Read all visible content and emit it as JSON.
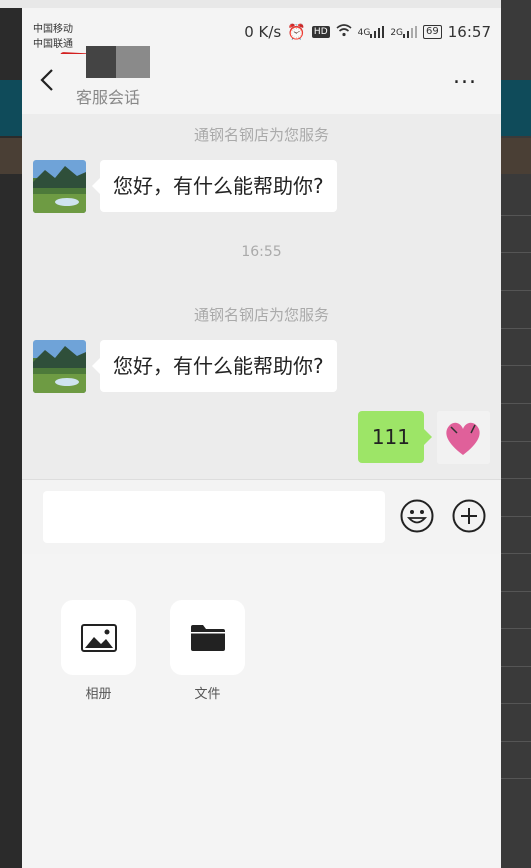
{
  "status_bar": {
    "carrier_1": "中国移动",
    "carrier_2": "中国联通",
    "net_speed": "0 K/s",
    "signal_1": "4G",
    "signal_2": "2G",
    "battery": "69",
    "time": "16:57"
  },
  "header": {
    "back_icon": "chevron-left-icon",
    "subtitle": "客服会话",
    "more_label": "..."
  },
  "messages": [
    {
      "type": "system",
      "text": "通钢名钢店为您服务"
    },
    {
      "type": "incoming",
      "text": "您好，有什么能帮助你?"
    },
    {
      "type": "time",
      "text": "16:55"
    },
    {
      "type": "system",
      "text": "通钢名钢店为您服务"
    },
    {
      "type": "incoming",
      "text": "您好，有什么能帮助你?"
    },
    {
      "type": "outgoing",
      "text": "111"
    }
  ],
  "input": {
    "value": "",
    "placeholder": ""
  },
  "toolbar": {
    "emoji_icon": "emoji-icon",
    "plus_icon": "plus-circle-icon"
  },
  "panel": {
    "items": [
      {
        "label": "相册",
        "icon": "image-icon"
      },
      {
        "label": "文件",
        "icon": "folder-icon"
      }
    ]
  },
  "colors": {
    "outgoing_bubble": "#9de567",
    "incoming_bubble": "#ffffff",
    "chat_bg": "#ececec"
  }
}
